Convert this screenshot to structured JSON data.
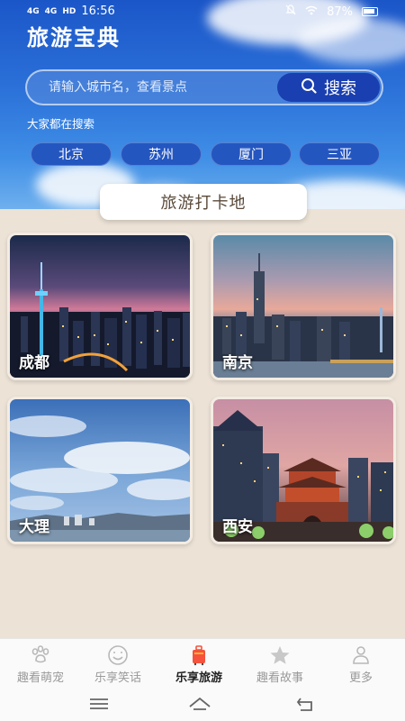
{
  "status_bar": {
    "time": "16:56",
    "battery": "87%",
    "signal_left": "4G",
    "signal_right": "4G",
    "hd": "HD"
  },
  "app": {
    "title": "旅游宝典"
  },
  "search": {
    "placeholder": "请输入城市名，查看景点",
    "button_label": "搜索"
  },
  "hot": {
    "label": "大家都在搜索",
    "cities": [
      "北京",
      "苏州",
      "厦门",
      "三亚"
    ]
  },
  "section": {
    "title": "旅游打卡地"
  },
  "cards": [
    {
      "label": "成都"
    },
    {
      "label": "南京"
    },
    {
      "label": "大理"
    },
    {
      "label": "西安"
    }
  ],
  "bottom_nav": [
    {
      "label": "趣看萌宠",
      "icon": "paw-icon"
    },
    {
      "label": "乐享笑话",
      "icon": "smile-icon"
    },
    {
      "label": "乐享旅游",
      "icon": "luggage-icon",
      "active": true
    },
    {
      "label": "趣看故事",
      "icon": "star-icon"
    },
    {
      "label": "更多",
      "icon": "person-icon"
    }
  ],
  "colors": {
    "accent": "#1a3fb0",
    "sky": "#2a6fd8",
    "background": "#ece2d6"
  }
}
